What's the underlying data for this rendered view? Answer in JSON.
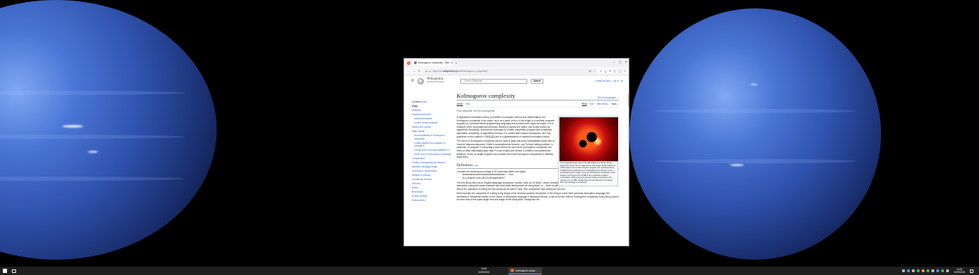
{
  "browser": {
    "tab_title": "Kolmogorov complexity - Wiki",
    "new_tab": "+",
    "url_prefix": "https://en.",
    "url_domain": "wikipedia.org",
    "url_path": "/wiki/Kolmogorov_complexity",
    "window_controls": [
      "—",
      "▢",
      "✕"
    ]
  },
  "wiki": {
    "logo_word": "Wikipedia",
    "logo_tagline": "The Free Encyclopedia",
    "search_placeholder": "Search Wikipedia",
    "search_button": "Search",
    "create_account": "Create account",
    "log_in": "Log in",
    "title": "Kolmogorov complexity",
    "languages": "33 languages",
    "tabs_left": [
      "Article",
      "Talk"
    ],
    "tabs_right": [
      "Read",
      "Edit",
      "View history",
      "Tools"
    ],
    "from": "From Wikipedia, the free encyclopedia",
    "toc_title": "Contents",
    "toc_hide": "[hide]",
    "toc": [
      {
        "label": "(Top)",
        "level": 0
      },
      {
        "label": "Definition",
        "level": 0
      },
      {
        "label": "Invariance theorem",
        "level": 0
      },
      {
        "label": "Informal treatment",
        "level": 1
      },
      {
        "label": "A more formal treatment",
        "level": 1
      },
      {
        "label": "History and context",
        "level": 0
      },
      {
        "label": "Basic results",
        "level": 0
      },
      {
        "label": "Uncomputability of Kolmogorov complexity",
        "level": 1
      },
      {
        "label": "A naive attempt at a program to compute K",
        "level": 1
      },
      {
        "label": "Formal proof of uncomputability of K",
        "level": 1
      },
      {
        "label": "Chain rule for Kolmogorov complexity",
        "level": 1
      },
      {
        "label": "Compression",
        "level": 0
      },
      {
        "label": "Chaitin's incompleteness theorem",
        "level": 0
      },
      {
        "label": "Minimum message length",
        "level": 0
      },
      {
        "label": "Kolmogorov randomness",
        "level": 0
      },
      {
        "label": "Relation to entropy",
        "level": 0
      },
      {
        "label": "Conditional versions",
        "level": 0
      },
      {
        "label": "See also",
        "level": 0
      },
      {
        "label": "Notes",
        "level": 0
      },
      {
        "label": "References",
        "level": 0
      },
      {
        "label": "Further reading",
        "level": 0
      },
      {
        "label": "External links",
        "level": 0
      }
    ],
    "intro_p1": "In algorithmic information theory (a subfield of computer science and mathematics), the Kolmogorov complexity of an object, such as a piece of text, is the length of a shortest computer program (in a predetermined programming language) that produces the object as output. It is a measure of the computational resources needed to specify the object, and is also known as algorithmic complexity, Solomonoff–Kolmogorov–Chaitin complexity, program-size complexity, descriptive complexity, or algorithmic entropy. It is named after Andrey Kolmogorov, who first published on the subject in 1963[1][2] and is a generalization of classical information theory.",
    "intro_p2": "The notion of Kolmogorov complexity can be used to state and prove impossibility results akin to Cantor's diagonal argument, Gödel's incompleteness theorem, and Turing's halting problem. In particular, no program P computing a lower bound for each text's Kolmogorov complexity can return a value essentially larger than P's own length (see section § Chaitin's incompleteness theorem); hence no single program can compute the exact Kolmogorov complexity for infinitely many texts.",
    "caption": "This image illustrates part of the Mandelbrot set fractal. Simply storing the 24-bit color of each pixel in this image would require 23 million bytes, but a small computer program can reproduce these 23 MB using the definition of the Mandelbrot set and the corner coordinates of the image. Thus, the Kolmogorov complexity of this image is much less than 23 MB in any pragmatic model of computation. PNG's general-purpose image compression only reduces it to 1.6 MB, smaller than the raw data but much larger than the Kolmogorov complexity.",
    "section_definition": "Definition",
    "edit_label": "[edit]",
    "def_p1": "Consider the following two strings of 32 lowercase letters and digits:",
    "string1": "abababababababababababababababab , and",
    "string2": "4c1j5b2p0cv4w1x8rx2y39umgw5q85s7",
    "def_p2": "The first string has a short English-language description, namely \"write ab 16 times\", which consists of 17 characters. The second one has no obvious simple description (using the same character set) other than writing down the string itself, i.e., \"write 4c1j5b2p0cv4w1x8rx2y39umgw5q85s7\" which has 38 characters. Hence the operation of writing the first string can be said to have \"less complexity\" than writing the second.",
    "def_p3": "More formally, the complexity of a string is the length of the shortest possible description of the string in some fixed universal description language (the sensitivity of complexity relative to the choice of description language is discussed below). It can be shown that the Kolmogorov complexity of any string cannot be more than a few bytes larger than the length of the string itself. Strings like the"
  },
  "taskbar": {
    "center_time": "13:28",
    "center_date": "02/25/2023",
    "app_label": "Kolmogorov compl...",
    "tray_time": "13:28",
    "tray_date": "02/25/2023"
  },
  "colors": {
    "link": "#3366cc",
    "taskbar_bg": "#1f1f1f",
    "desktop_bg": "#000000"
  }
}
